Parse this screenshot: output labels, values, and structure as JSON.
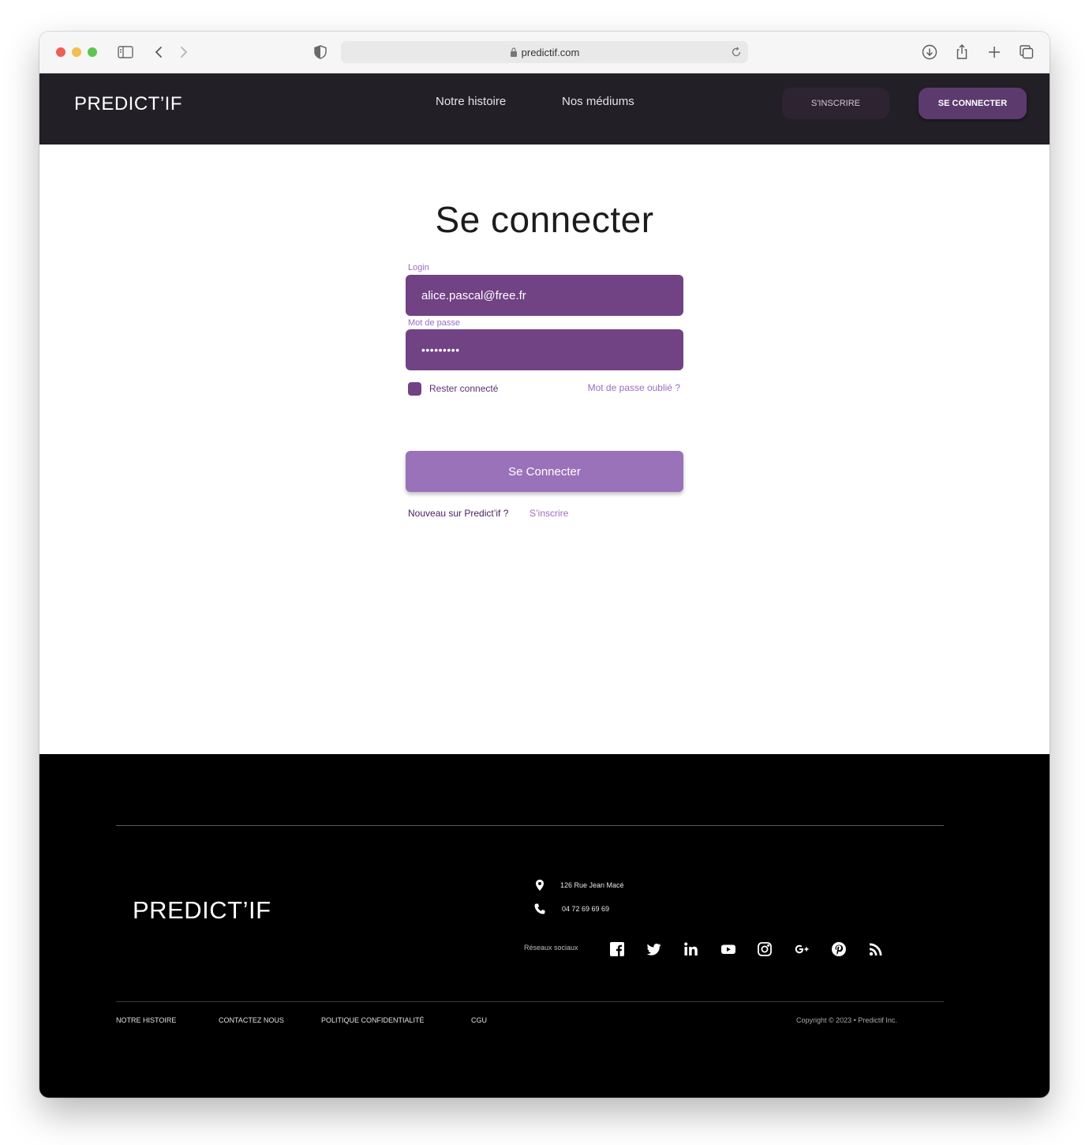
{
  "browser": {
    "url": "predictif.com"
  },
  "header": {
    "brand": "PREDICT’IF",
    "nav": [
      {
        "label": "Notre histoire"
      },
      {
        "label": "Nos médiums"
      }
    ],
    "signup_label": "S'INSCRIRE",
    "login_label": "SE CONNECTER"
  },
  "login_form": {
    "title": "Se connecter",
    "login_label": "Login",
    "login_value": "alice.pascal@free.fr",
    "password_label": "Mot de passe",
    "password_value": "•••••••••",
    "remember_label": "Rester connecté",
    "remember_checked": true,
    "forgot_label": "Mot de passe oublié ?",
    "submit_label": "Se Connecter",
    "new_user_text": "Nouveau sur Predict’if ?",
    "signup_link": "S’inscrire"
  },
  "footer": {
    "brand": "PREDICT’IF",
    "address": "126 Rue Jean Macé",
    "phone": "04 72 69 69 69",
    "social_label": "Réseaux sociaux",
    "social_icons": [
      "facebook-icon",
      "twitter-icon",
      "linkedin-icon",
      "youtube-icon",
      "instagram-icon",
      "google-plus-icon",
      "pinterest-icon",
      "rss-icon"
    ],
    "links": [
      {
        "label": "NOTRE HISTOIRE"
      },
      {
        "label": "CONTACTEZ NOUS"
      },
      {
        "label": "POLITIQUE CONFIDENTIALITÉ"
      },
      {
        "label": "CGU"
      }
    ],
    "copyright": "Copyright © 2023 • Predictif Inc."
  },
  "colors": {
    "header_bg": "#231f26",
    "accent": "#714284",
    "accent_light": "#9a72b9",
    "footer_bg": "#000000"
  }
}
